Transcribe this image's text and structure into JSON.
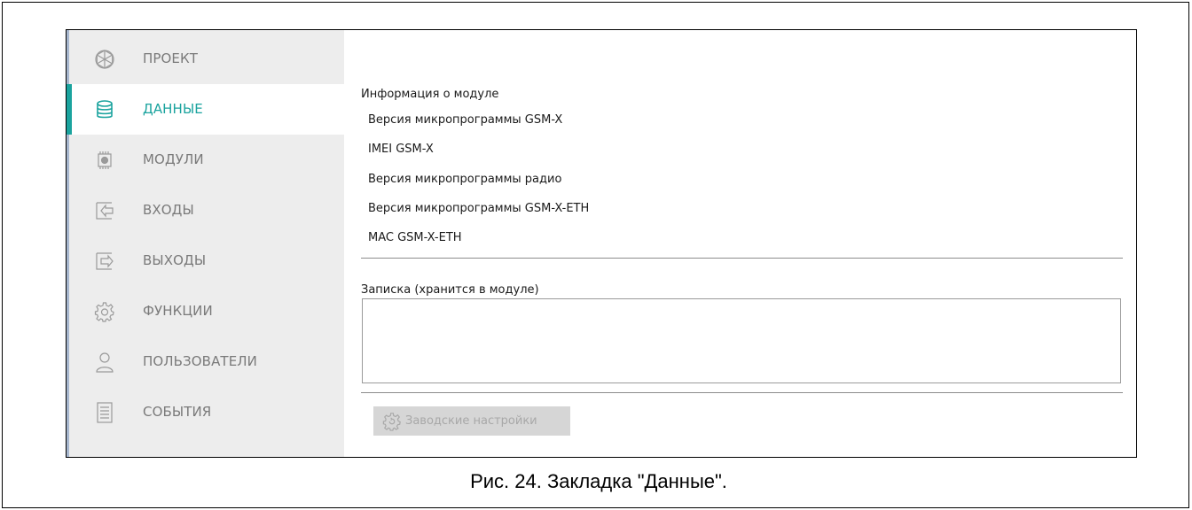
{
  "sidebar": {
    "items": [
      {
        "label": "ПРОЕКТ",
        "icon": "project-icon",
        "active": false
      },
      {
        "label": "ДАННЫЕ",
        "icon": "database-icon",
        "active": true
      },
      {
        "label": "МОДУЛИ",
        "icon": "module-chip-icon",
        "active": false
      },
      {
        "label": "ВХОДЫ",
        "icon": "input-arrow-icon",
        "active": false
      },
      {
        "label": "ВЫХОДЫ",
        "icon": "output-arrow-icon",
        "active": false
      },
      {
        "label": "ФУНКЦИИ",
        "icon": "gear-icon",
        "active": false
      },
      {
        "label": "ПОЛЬЗОВАТЕЛИ",
        "icon": "user-icon",
        "active": false
      },
      {
        "label": "СОБЫТИЯ",
        "icon": "event-log-icon",
        "active": false
      }
    ]
  },
  "main": {
    "module_info_title": "Информация о модуле",
    "info_rows": [
      "Версия микропрограммы GSM-X",
      "IMEI GSM-X",
      "Версия микропрограммы радио",
      "Версия микропрограммы GSM-X-ETH",
      "MAC GSM-X-ETH"
    ],
    "note_label": "Записка (хранится в модуле)",
    "note_value": "",
    "factory_button_label": "Заводские настройки"
  },
  "caption": "Рис. 24. Закладка \"Данные\".",
  "colors": {
    "accent": "#1aa39e",
    "sidebar_bg": "#ededed",
    "sidebar_edge": "#a7b7cf",
    "disabled_button_bg": "#d6d6d6"
  }
}
